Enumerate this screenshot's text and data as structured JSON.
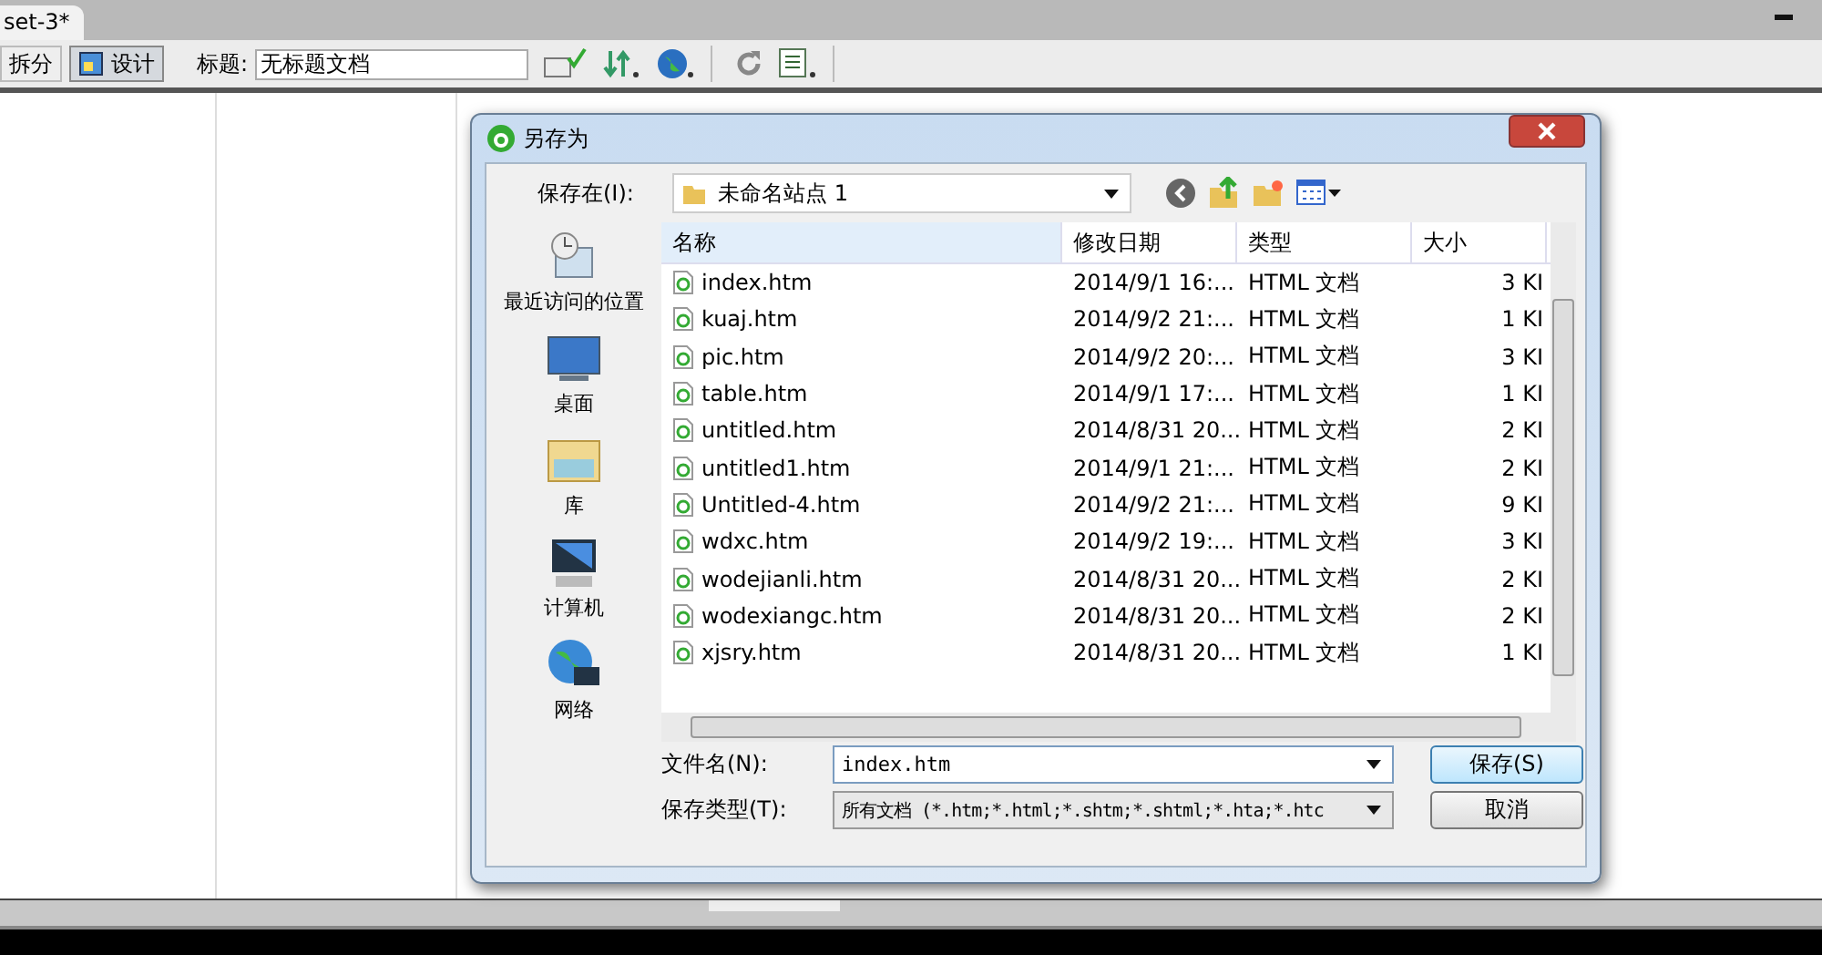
{
  "document_tab": {
    "title": "set-3*"
  },
  "toolbar": {
    "view_buttons": [
      {
        "label": "拆分",
        "selected": false
      },
      {
        "label": "设计",
        "selected": true
      }
    ],
    "title_label": "标题:",
    "title_value": "无标题文档"
  },
  "dialog": {
    "title": "另存为",
    "save_in_label": "保存在(I):",
    "location": "未命名站点 1",
    "places": [
      {
        "label": "最近访问的位置",
        "kind": "recent"
      },
      {
        "label": "桌面",
        "kind": "desktop"
      },
      {
        "label": "库",
        "kind": "library"
      },
      {
        "label": "计算机",
        "kind": "computer"
      },
      {
        "label": "网络",
        "kind": "network"
      }
    ],
    "columns": [
      "名称",
      "修改日期",
      "类型",
      "大小"
    ],
    "rows": [
      {
        "name": "index.htm",
        "date": "2014/9/1 16:...",
        "type": "HTML 文档",
        "size": "3 KI"
      },
      {
        "name": "kuaj.htm",
        "date": "2014/9/2 21:...",
        "type": "HTML 文档",
        "size": "1 KI"
      },
      {
        "name": "pic.htm",
        "date": "2014/9/2 20:...",
        "type": "HTML 文档",
        "size": "3 KI"
      },
      {
        "name": "table.htm",
        "date": "2014/9/1 17:...",
        "type": "HTML 文档",
        "size": "1 KI"
      },
      {
        "name": "untitled.htm",
        "date": "2014/8/31 20...",
        "type": "HTML 文档",
        "size": "2 KI"
      },
      {
        "name": "untitled1.htm",
        "date": "2014/9/1 21:...",
        "type": "HTML 文档",
        "size": "2 KI"
      },
      {
        "name": "Untitled-4.htm",
        "date": "2014/9/2 21:...",
        "type": "HTML 文档",
        "size": "9 KI"
      },
      {
        "name": "wdxc.htm",
        "date": "2014/9/2 19:...",
        "type": "HTML 文档",
        "size": "3 KI"
      },
      {
        "name": "wodejianli.htm",
        "date": "2014/8/31 20...",
        "type": "HTML 文档",
        "size": "2 KI"
      },
      {
        "name": "wodexiangc.htm",
        "date": "2014/8/31 20...",
        "type": "HTML 文档",
        "size": "2 KI"
      },
      {
        "name": "xjsry.htm",
        "date": "2014/8/31 20...",
        "type": "HTML 文档",
        "size": "1 KI"
      }
    ],
    "filename_label": "文件名(N):",
    "filename_value": "index.htm",
    "filetype_label": "保存类型(T):",
    "filetype_value": "所有文档 (*.htm;*.html;*.shtm;*.shtml;*.hta;*.htc",
    "buttons": [
      "保存(S)",
      "取消"
    ]
  }
}
